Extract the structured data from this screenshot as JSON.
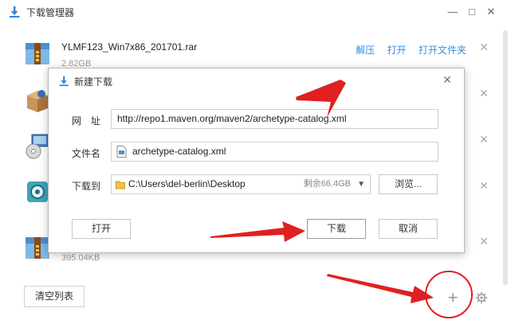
{
  "window": {
    "title": "下载管理器",
    "controls": {
      "minimize": "—",
      "restore": "□",
      "close": "✕"
    }
  },
  "downloads": [
    {
      "name": "YLMF123_Win7x86_201701.rar",
      "size": "2.82GB",
      "actions": [
        "解压",
        "打开",
        "打开文件夹"
      ],
      "remove": "✕",
      "icon": "rar-archive-icon"
    },
    {
      "name": "",
      "size": "",
      "actions": [],
      "remove": "✕",
      "icon": "installer-box-icon"
    },
    {
      "name": "",
      "size": "",
      "actions": [],
      "remove": "✕",
      "icon": "setup-cd-icon"
    },
    {
      "name": "",
      "size": "",
      "actions": [],
      "remove": "✕",
      "icon": "gear-app-icon"
    },
    {
      "name": "",
      "size": "395.04KB",
      "actions": [],
      "remove": "✕",
      "icon": "rar-archive-icon"
    }
  ],
  "footer": {
    "clear_label": "清空列表",
    "add_label": "+",
    "settings_icon": "gear-icon"
  },
  "dialog": {
    "title": "新建下载",
    "close": "✕",
    "url_label": "网　址",
    "url_value": "http://repo1.maven.org/maven2/archetype-catalog.xml",
    "filename_label": "文件名",
    "filename_value": "archetype-catalog.xml",
    "saveto_label": "下载到",
    "saveto_value": "C:\\Users\\del-berlin\\Desktop",
    "free_space": "剩余66.4GB",
    "browse_label": "浏览...",
    "open_label": "打开",
    "download_label": "下载",
    "cancel_label": "取消"
  },
  "colors": {
    "accent": "#3a8ee6",
    "annotation": "#e02020"
  }
}
